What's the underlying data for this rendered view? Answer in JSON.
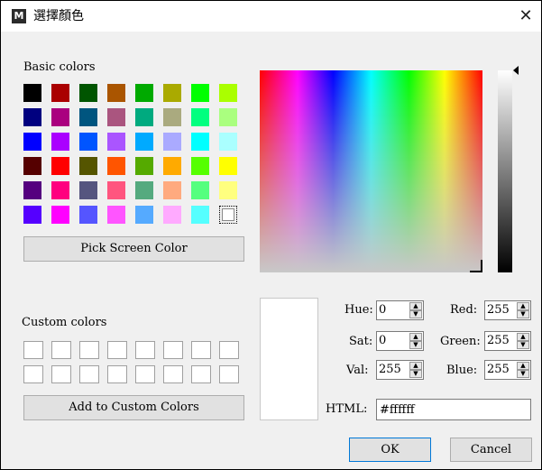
{
  "window": {
    "title": "選擇顏色",
    "app_icon": "M"
  },
  "basic": {
    "label": "Basic colors",
    "colors": [
      [
        "#000000",
        "#aa0000",
        "#005500",
        "#aa5500",
        "#00aa00",
        "#aaaa00",
        "#00ff00",
        "#aaff00"
      ],
      [
        "#00007f",
        "#aa007f",
        "#00557f",
        "#aa557f",
        "#00aa7f",
        "#aaaa7f",
        "#00ff7f",
        "#aaff7f"
      ],
      [
        "#0000ff",
        "#aa00ff",
        "#0055ff",
        "#aa55ff",
        "#00aaff",
        "#aaaaff",
        "#00ffff",
        "#aaffff"
      ],
      [
        "#550000",
        "#ff0000",
        "#555500",
        "#ff5500",
        "#55aa00",
        "#ffaa00",
        "#55ff00",
        "#ffff00"
      ],
      [
        "#55007f",
        "#ff007f",
        "#55557f",
        "#ff557f",
        "#55aa7f",
        "#ffaa7f",
        "#55ff7f",
        "#ffff7f"
      ],
      [
        "#5500ff",
        "#ff00ff",
        "#5555ff",
        "#ff55ff",
        "#55aaff",
        "#ffaaff",
        "#55ffff",
        "#ffffff"
      ]
    ],
    "selected": "#ffffff"
  },
  "pick_button": "Pick Screen Color",
  "custom": {
    "label": "Custom colors",
    "colors": [
      "#ffffff",
      "#ffffff",
      "#ffffff",
      "#ffffff",
      "#ffffff",
      "#ffffff",
      "#ffffff",
      "#ffffff",
      "#ffffff",
      "#ffffff",
      "#ffffff",
      "#ffffff",
      "#ffffff",
      "#ffffff",
      "#ffffff",
      "#ffffff"
    ]
  },
  "add_button": "Add to Custom Colors",
  "current_color": "#ffffff",
  "fields": {
    "hue_label": "Hue:",
    "hue": "0",
    "sat_label": "Sat:",
    "sat": "0",
    "val_label": "Val:",
    "val": "255",
    "red_label": "Red:",
    "red": "255",
    "green_label": "Green:",
    "green": "255",
    "blue_label": "Blue:",
    "blue": "255",
    "html_label": "HTML:",
    "html": "#ffffff"
  },
  "ok_button": "OK",
  "cancel_button": "Cancel",
  "icons": {
    "close": "close-icon",
    "spin_up": "arrow-up-icon",
    "spin_down": "arrow-down-icon"
  }
}
